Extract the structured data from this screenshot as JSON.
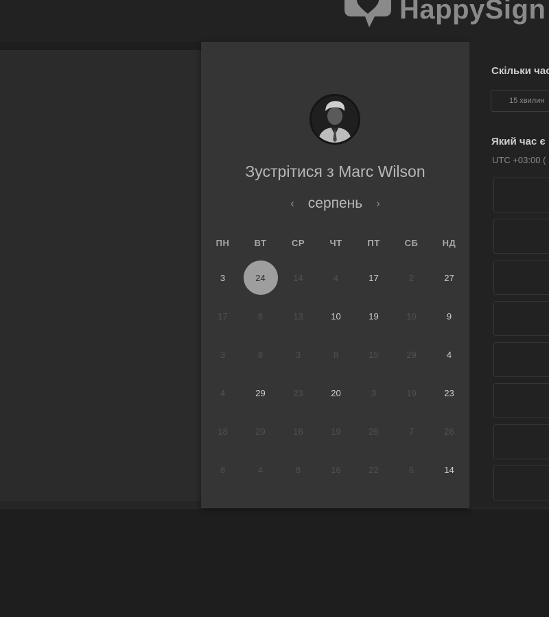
{
  "header": {
    "logo_text": "HappySign"
  },
  "calendar": {
    "title": "Зустрітися з Marc Wilson",
    "month": "серпень",
    "prev_icon": "‹",
    "next_icon": "›",
    "weekdays": [
      "ПН",
      "ВТ",
      "СР",
      "ЧТ",
      "ПТ",
      "СБ",
      "НД"
    ],
    "weeks": [
      [
        {
          "d": "3",
          "on": true
        },
        {
          "d": "24",
          "on": true,
          "sel": true
        },
        {
          "d": "14",
          "on": false
        },
        {
          "d": "4",
          "on": false
        },
        {
          "d": "17",
          "on": true
        },
        {
          "d": "2",
          "on": false
        },
        {
          "d": "27",
          "on": true
        }
      ],
      [
        {
          "d": "17",
          "on": false
        },
        {
          "d": "8",
          "on": false
        },
        {
          "d": "13",
          "on": false
        },
        {
          "d": "10",
          "on": true
        },
        {
          "d": "19",
          "on": true
        },
        {
          "d": "10",
          "on": false
        },
        {
          "d": "9",
          "on": true
        }
      ],
      [
        {
          "d": "3",
          "on": false
        },
        {
          "d": "8",
          "on": false
        },
        {
          "d": "3",
          "on": false
        },
        {
          "d": "8",
          "on": false
        },
        {
          "d": "15",
          "on": false
        },
        {
          "d": "29",
          "on": false
        },
        {
          "d": "4",
          "on": true
        }
      ],
      [
        {
          "d": "4",
          "on": false
        },
        {
          "d": "29",
          "on": true
        },
        {
          "d": "23",
          "on": false
        },
        {
          "d": "20",
          "on": true
        },
        {
          "d": "3",
          "on": false
        },
        {
          "d": "19",
          "on": false
        },
        {
          "d": "23",
          "on": true
        }
      ],
      [
        {
          "d": "18",
          "on": false
        },
        {
          "d": "29",
          "on": false
        },
        {
          "d": "16",
          "on": false
        },
        {
          "d": "19",
          "on": false
        },
        {
          "d": "26",
          "on": false
        },
        {
          "d": "7",
          "on": false
        },
        {
          "d": "26",
          "on": false
        }
      ],
      [
        {
          "d": "8",
          "on": false
        },
        {
          "d": "4",
          "on": false
        },
        {
          "d": "8",
          "on": false
        },
        {
          "d": "16",
          "on": false
        },
        {
          "d": "22",
          "on": false
        },
        {
          "d": "6",
          "on": false
        },
        {
          "d": "14",
          "on": true
        }
      ]
    ]
  },
  "booking": {
    "duration_question": "Скільки час",
    "duration_value": "15 хвилин",
    "time_question": "Який час є",
    "timezone": "UTC +03:00 (",
    "slot_count": 8
  }
}
